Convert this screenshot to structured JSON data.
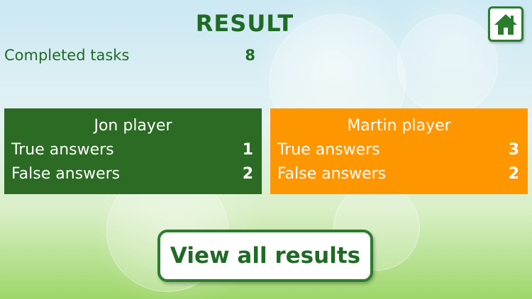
{
  "screen": {
    "title": "RESULT"
  },
  "home_button": {
    "icon": "home-icon"
  },
  "summary": {
    "completed_label": "Completed tasks",
    "completed_value": "8"
  },
  "players": [
    {
      "name": "Jon player",
      "true_label": "True answers",
      "true_value": "1",
      "false_label": "False answers",
      "false_value": "2",
      "color": "#2b6b23"
    },
    {
      "name": "Martin player",
      "true_label": "True answers",
      "true_value": "3",
      "false_label": "False answers",
      "false_value": "2",
      "color": "#fe9600"
    }
  ],
  "actions": {
    "view_all_label": "View all results"
  },
  "colors": {
    "text_green": "#1f6b24",
    "button_border": "#2b7d2e"
  }
}
